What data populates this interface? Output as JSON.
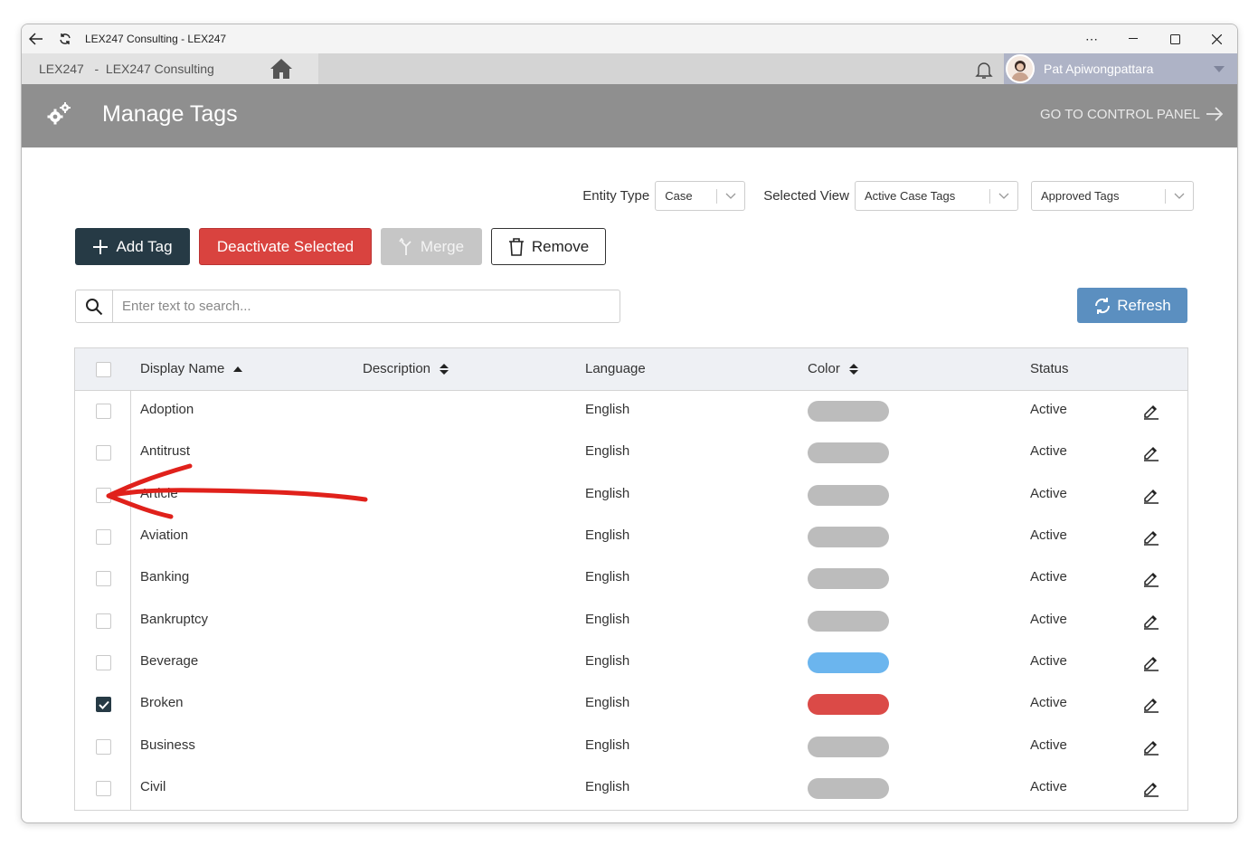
{
  "window": {
    "title": "LEX247 Consulting - LEX247"
  },
  "nav": {
    "breadcrumb": "LEX247   -  LEX247 Consulting",
    "user_name": "Pat Apiwongpattara"
  },
  "header": {
    "title": "Manage Tags",
    "control_panel_link": "GO TO CONTROL PANEL"
  },
  "filters": {
    "entity_type_label": "Entity Type",
    "entity_type_value": "Case",
    "selected_view_label": "Selected View",
    "selected_view_value": "Active Case Tags",
    "approval_value": "Approved Tags"
  },
  "toolbar": {
    "add_label": "Add Tag",
    "deactivate_label": "Deactivate Selected",
    "merge_label": "Merge",
    "remove_label": "Remove"
  },
  "search": {
    "placeholder": "Enter text to search..."
  },
  "refresh_label": "Refresh",
  "table": {
    "columns": [
      "Display Name",
      "Description",
      "Language",
      "Color",
      "Status"
    ],
    "rows": [
      {
        "name": "Adoption",
        "language": "English",
        "color": "#bcbcbc",
        "status": "Active",
        "checked": false
      },
      {
        "name": "Antitrust",
        "language": "English",
        "color": "#bcbcbc",
        "status": "Active",
        "checked": false
      },
      {
        "name": "Article",
        "language": "English",
        "color": "#bcbcbc",
        "status": "Active",
        "checked": false
      },
      {
        "name": "Aviation",
        "language": "English",
        "color": "#bcbcbc",
        "status": "Active",
        "checked": false
      },
      {
        "name": "Banking",
        "language": "English",
        "color": "#bcbcbc",
        "status": "Active",
        "checked": false
      },
      {
        "name": "Bankruptcy",
        "language": "English",
        "color": "#bcbcbc",
        "status": "Active",
        "checked": false
      },
      {
        "name": "Beverage",
        "language": "English",
        "color": "#6bb5ee",
        "status": "Active",
        "checked": false
      },
      {
        "name": "Broken",
        "language": "English",
        "color": "#db4a47",
        "status": "Active",
        "checked": true
      },
      {
        "name": "Business",
        "language": "English",
        "color": "#bcbcbc",
        "status": "Active",
        "checked": false
      },
      {
        "name": "Civil",
        "language": "English",
        "color": "#bcbcbc",
        "status": "Active",
        "checked": false
      }
    ]
  }
}
